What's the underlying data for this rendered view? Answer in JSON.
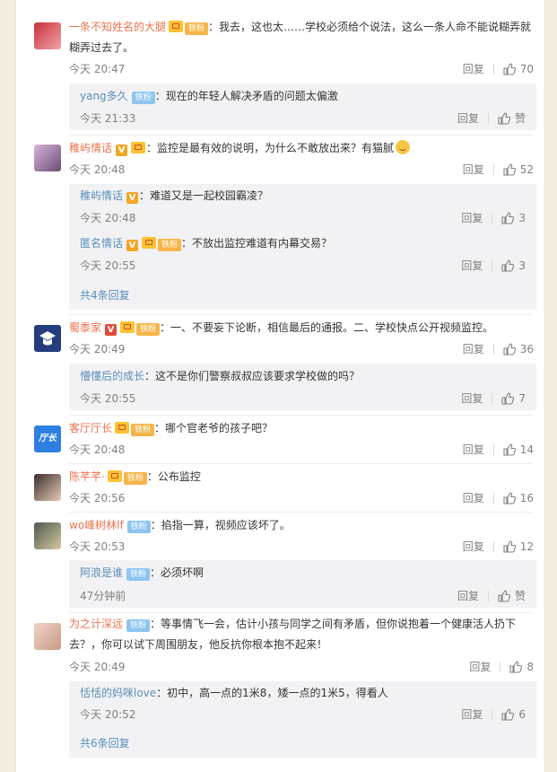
{
  "labels": {
    "reply": "回复",
    "like": "赞"
  },
  "comments": [
    {
      "user": "一条不知姓名的大腿",
      "fan_label": "铁粉",
      "text": "：我去，这也太……学校必须给个说法，这么一条人命不能说糊弄就糊弄过去了。",
      "time": "今天 20:47",
      "likes": "70",
      "replies": [
        {
          "user": "yang多久",
          "fan_label": "铁粉",
          "text": "：现在的年轻人解决矛盾的问题太偏激",
          "time": "今天 21:33",
          "likes": "赞"
        }
      ],
      "more": ""
    },
    {
      "user": "稚屿情话",
      "text": "：监控是最有效的说明，为什么不敢放出来？有猫腻",
      "time": "今天 20:48",
      "likes": "52",
      "replies": [
        {
          "user": "稚屿情话",
          "text": "：难道又是一起校园霸凌？",
          "time": "今天 20:48",
          "likes": "3"
        },
        {
          "user": "匿名情话",
          "fan_label": "铁粉",
          "text": "：不放出监控难道有内幕交易？",
          "time": "今天 20:55",
          "likes": "3"
        }
      ],
      "more": "共4条回复"
    },
    {
      "user": "蜀黍家",
      "fan_label": "铁粉",
      "text": "：一、不要妄下论断，相信最后的通报。二、学校快点公开视频监控。",
      "time": "今天 20:49",
      "likes": "36",
      "replies": [
        {
          "user": "懵懂后的成长",
          "text": "：这不是你们警察叔叔应该要求学校做的吗？",
          "time": "今天 20:55",
          "likes": "7"
        }
      ],
      "more": ""
    },
    {
      "user": "客厅厅长",
      "avatar_text": "厅长",
      "fan_label": "铁粉",
      "text": "：哪个官老爷的孩子吧？",
      "time": "今天 20:48",
      "likes": "14",
      "replies": [],
      "more": ""
    },
    {
      "user": "陈芊芊·",
      "fan_label": "铁粉",
      "text": "：公布监控",
      "time": "今天 20:56",
      "likes": "16",
      "replies": [],
      "more": ""
    },
    {
      "user": "wo峰树林lf",
      "fan_label": "铁粉",
      "text": "：掐指一算，视频应该坏了。",
      "time": "今天 20:53",
      "likes": "12",
      "replies": [
        {
          "user": "阿浪是谁",
          "fan_label": "铁粉",
          "text": "：必须坏啊",
          "time": "47分钟前",
          "likes": "赞"
        }
      ],
      "more": ""
    },
    {
      "user": "为之计深远",
      "fan_label": "铁粉",
      "text": "：等事情飞一会，估计小孩与同学之间有矛盾，但你说抱着一个健康活人扔下去？，你可以试下周围朋友，他反抗你根本抱不起来！",
      "time": "今天 20:49",
      "likes": "8",
      "replies": [
        {
          "user": "恬恬的妈咪love",
          "text": "：初中，高一点的1米8，矮一点的1米5，得看人",
          "time": "今天 20:52",
          "likes": "6"
        }
      ],
      "more": "共6条回复"
    }
  ],
  "colors": {
    "username": "#eb7350",
    "reply_username": "#5a8eb8",
    "fan_gold": "#f6b54a",
    "fan_blue": "#8ec6ef",
    "v_gold": "#f5a623",
    "v_red": "#e24b3c"
  }
}
